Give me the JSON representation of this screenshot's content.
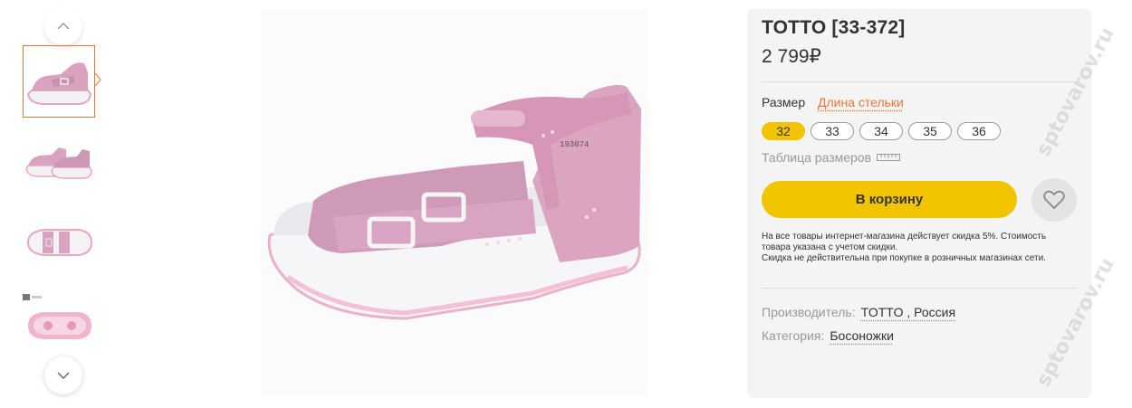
{
  "gallery": {
    "thumbnails": [
      {
        "name": "thumb-side-view",
        "active": true
      },
      {
        "name": "thumb-pair-view",
        "active": false
      },
      {
        "name": "thumb-top-view",
        "active": false
      },
      {
        "name": "thumb-sole-view",
        "active": false
      }
    ],
    "scroll_up_icon": "chevron-up-icon",
    "scroll_down_icon": "chevron-down-icon",
    "insole_stamp": "193074"
  },
  "product": {
    "title": "TOTTO [33-372]",
    "price": "2 799₽",
    "size_label": "Размер",
    "insole_link": "Длина стельки",
    "sizes": [
      {
        "label": "32",
        "selected": true
      },
      {
        "label": "33",
        "selected": false
      },
      {
        "label": "34",
        "selected": false
      },
      {
        "label": "35",
        "selected": false
      },
      {
        "label": "36",
        "selected": false
      }
    ],
    "size_table_link": "Таблица размеров",
    "size_table_icon": "ruler-icon",
    "add_to_cart": "В корзину",
    "favorite_icon": "heart-icon",
    "note_line1": "На все товары интернет-магазина действует скидка 5%. Стоимость товара указана с учетом скидки.",
    "note_line2": "Скидка не действительна при покупке в розничных магазинах сети.",
    "manufacturer_label": "Производитель:",
    "manufacturer_value": "TOTTO , Россия",
    "category_label": "Категория:",
    "category_value": "Босоножки"
  },
  "watermark": "sptovarov.ru",
  "colors": {
    "accent_yellow": "#f2c400",
    "accent_orange": "#e8763a",
    "panel_bg": "#f4f4f4",
    "shoe_pink": "#d9a3c0",
    "sole_white": "#f3f3f6"
  }
}
